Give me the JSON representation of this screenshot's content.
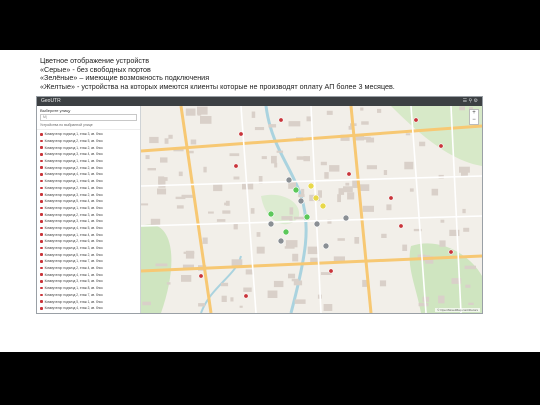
{
  "caption": {
    "line1": "Цветное отображение устройств",
    "line2": "«Серые» - без свободных портов",
    "line3": "«Зелёные» – имеющие возможность подключения",
    "line4": "«Желтые» - устройства на которых имеются клиенты которые не производят оплату АП более 3 месяцев."
  },
  "app": {
    "brand": "GeoUTR",
    "tools": "☰ ⚲ ⚙"
  },
  "sidebar": {
    "title": "Выберите улицу",
    "search_value": "M|",
    "subtitle": "Устройства по выбранной улице",
    "items": [
      {
        "label": "Коммутатор подъезд 1, этаж 3, кв. блок",
        "status": "red"
      },
      {
        "label": "Коммутатор подъезд 2, этаж 5, кв. блок",
        "status": "red"
      },
      {
        "label": "Коммутатор подъезд 1, этаж 2, кв. блок",
        "status": "red"
      },
      {
        "label": "Коммутатор подъезд 3, этаж 4, кв. блок",
        "status": "red"
      },
      {
        "label": "Коммутатор подъезд 1, этаж 1, кв. блок",
        "status": "red"
      },
      {
        "label": "Коммутатор подъезд 2, этаж 2, кв. блок",
        "status": "red"
      },
      {
        "label": "Коммутатор подъезд 4, этаж 3, кв. блок",
        "status": "red"
      },
      {
        "label": "Коммутатор подъезд 1, этаж 6, кв. блок",
        "status": "red"
      },
      {
        "label": "Коммутатор подъезд 2, этаж 1, кв. блок",
        "status": "red"
      },
      {
        "label": "Коммутатор подъезд 3, этаж 2, кв. блок",
        "status": "red"
      },
      {
        "label": "Коммутатор подъезд 5, этаж 4, кв. блок",
        "status": "red"
      },
      {
        "label": "Коммутатор подъезд 1, этаж 5, кв. блок",
        "status": "red"
      },
      {
        "label": "Коммутатор подъезд 2, этаж 3, кв. блок",
        "status": "red"
      },
      {
        "label": "Коммутатор подъезд 3, этаж 1, кв. блок",
        "status": "red"
      },
      {
        "label": "Коммутатор подъезд 4, этаж 5, кв. блок",
        "status": "red"
      },
      {
        "label": "Коммутатор подъезд 1, этаж 4, кв. блок",
        "status": "red"
      },
      {
        "label": "Коммутатор подъезд 2, этаж 6, кв. блок",
        "status": "red"
      },
      {
        "label": "Коммутатор подъезд 3, этаж 3, кв. блок",
        "status": "red"
      },
      {
        "label": "Коммутатор подъезд 5, этаж 2, кв. блок",
        "status": "red"
      },
      {
        "label": "Коммутатор подъезд 1, этаж 7, кв. блок",
        "status": "red"
      },
      {
        "label": "Коммутатор подъезд 2, этаж 4, кв. блок",
        "status": "red"
      },
      {
        "label": "Коммутатор подъезд 4, этаж 1, кв. блок",
        "status": "red"
      },
      {
        "label": "Коммутатор подъезд 3, этаж 5, кв. блок",
        "status": "red"
      },
      {
        "label": "Коммутатор подъезд 1, этаж 8, кв. блок",
        "status": "red"
      },
      {
        "label": "Коммутатор подъезд 2, этаж 7, кв. блок",
        "status": "red"
      },
      {
        "label": "Коммутатор подъезд 5, этаж 1, кв. блок",
        "status": "red"
      },
      {
        "label": "Коммутатор подъезд 4, этаж 2, кв. блок",
        "status": "red"
      },
      {
        "label": "Коммутатор подъезд 3, этаж 6, кв. блок",
        "status": "red"
      },
      {
        "label": "Коммутатор подъезд 1, этаж 9, кв. блок",
        "status": "red"
      }
    ]
  },
  "map": {
    "zoom_in": "+",
    "zoom_out": "−",
    "attribution": "© OpenStreetMap contributors",
    "colors": {
      "gray": "#8a8f94",
      "green": "#5cc85a",
      "yellow": "#e8d84a",
      "red": "#c9343a"
    },
    "markers": [
      {
        "status": "red"
      },
      {
        "status": "red"
      },
      {
        "status": "red"
      },
      {
        "status": "red"
      },
      {
        "status": "red"
      },
      {
        "status": "red"
      },
      {
        "status": "red"
      },
      {
        "status": "red"
      },
      {
        "status": "red"
      },
      {
        "status": "red"
      },
      {
        "status": "red"
      },
      {
        "status": "red"
      },
      {
        "status": "gray"
      },
      {
        "status": "gray"
      },
      {
        "status": "gray"
      },
      {
        "status": "gray"
      },
      {
        "status": "gray"
      },
      {
        "status": "gray"
      },
      {
        "status": "gray"
      },
      {
        "status": "green"
      },
      {
        "status": "green"
      },
      {
        "status": "green"
      },
      {
        "status": "green"
      },
      {
        "status": "yellow"
      },
      {
        "status": "yellow"
      },
      {
        "status": "yellow"
      }
    ]
  }
}
